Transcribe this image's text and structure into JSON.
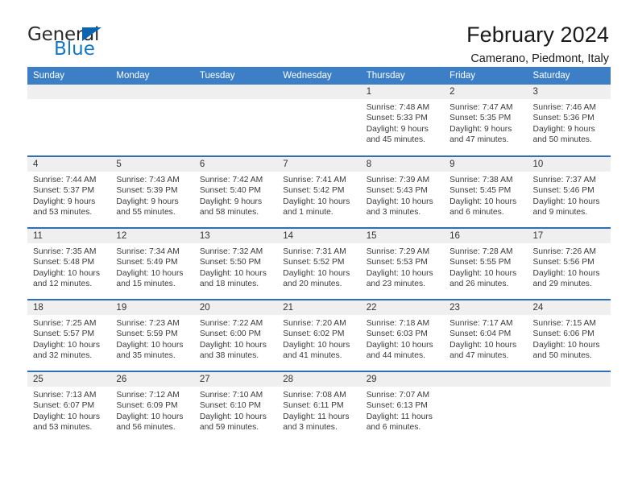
{
  "logo": {
    "word_one": "General",
    "word_two": "Blue",
    "triangle_color": "#0a64b0",
    "text_color": "#2a2a2a",
    "blue_color": "#1277c4"
  },
  "header": {
    "title": "February 2024",
    "subtitle": "Camerano, Piedmont, Italy",
    "header_bg": "#3c7fc6",
    "row_divider": "#2f6fb5",
    "daynum_bg": "#efefef"
  },
  "weekday_headers": [
    "Sunday",
    "Monday",
    "Tuesday",
    "Wednesday",
    "Thursday",
    "Friday",
    "Saturday"
  ],
  "weeks": [
    [
      {
        "day": "",
        "empty": true,
        "line1": "",
        "line2": "",
        "line3": "",
        "line4": ""
      },
      {
        "day": "",
        "empty": true,
        "line1": "",
        "line2": "",
        "line3": "",
        "line4": ""
      },
      {
        "day": "",
        "empty": true,
        "line1": "",
        "line2": "",
        "line3": "",
        "line4": ""
      },
      {
        "day": "",
        "empty": true,
        "line1": "",
        "line2": "",
        "line3": "",
        "line4": ""
      },
      {
        "day": "1",
        "empty": false,
        "line1": "Sunrise: 7:48 AM",
        "line2": "Sunset: 5:33 PM",
        "line3": "Daylight: 9 hours",
        "line4": "and 45 minutes."
      },
      {
        "day": "2",
        "empty": false,
        "line1": "Sunrise: 7:47 AM",
        "line2": "Sunset: 5:35 PM",
        "line3": "Daylight: 9 hours",
        "line4": "and 47 minutes."
      },
      {
        "day": "3",
        "empty": false,
        "line1": "Sunrise: 7:46 AM",
        "line2": "Sunset: 5:36 PM",
        "line3": "Daylight: 9 hours",
        "line4": "and 50 minutes."
      }
    ],
    [
      {
        "day": "4",
        "empty": false,
        "line1": "Sunrise: 7:44 AM",
        "line2": "Sunset: 5:37 PM",
        "line3": "Daylight: 9 hours",
        "line4": "and 53 minutes."
      },
      {
        "day": "5",
        "empty": false,
        "line1": "Sunrise: 7:43 AM",
        "line2": "Sunset: 5:39 PM",
        "line3": "Daylight: 9 hours",
        "line4": "and 55 minutes."
      },
      {
        "day": "6",
        "empty": false,
        "line1": "Sunrise: 7:42 AM",
        "line2": "Sunset: 5:40 PM",
        "line3": "Daylight: 9 hours",
        "line4": "and 58 minutes."
      },
      {
        "day": "7",
        "empty": false,
        "line1": "Sunrise: 7:41 AM",
        "line2": "Sunset: 5:42 PM",
        "line3": "Daylight: 10 hours",
        "line4": "and 1 minute."
      },
      {
        "day": "8",
        "empty": false,
        "line1": "Sunrise: 7:39 AM",
        "line2": "Sunset: 5:43 PM",
        "line3": "Daylight: 10 hours",
        "line4": "and 3 minutes."
      },
      {
        "day": "9",
        "empty": false,
        "line1": "Sunrise: 7:38 AM",
        "line2": "Sunset: 5:45 PM",
        "line3": "Daylight: 10 hours",
        "line4": "and 6 minutes."
      },
      {
        "day": "10",
        "empty": false,
        "line1": "Sunrise: 7:37 AM",
        "line2": "Sunset: 5:46 PM",
        "line3": "Daylight: 10 hours",
        "line4": "and 9 minutes."
      }
    ],
    [
      {
        "day": "11",
        "empty": false,
        "line1": "Sunrise: 7:35 AM",
        "line2": "Sunset: 5:48 PM",
        "line3": "Daylight: 10 hours",
        "line4": "and 12 minutes."
      },
      {
        "day": "12",
        "empty": false,
        "line1": "Sunrise: 7:34 AM",
        "line2": "Sunset: 5:49 PM",
        "line3": "Daylight: 10 hours",
        "line4": "and 15 minutes."
      },
      {
        "day": "13",
        "empty": false,
        "line1": "Sunrise: 7:32 AM",
        "line2": "Sunset: 5:50 PM",
        "line3": "Daylight: 10 hours",
        "line4": "and 18 minutes."
      },
      {
        "day": "14",
        "empty": false,
        "line1": "Sunrise: 7:31 AM",
        "line2": "Sunset: 5:52 PM",
        "line3": "Daylight: 10 hours",
        "line4": "and 20 minutes."
      },
      {
        "day": "15",
        "empty": false,
        "line1": "Sunrise: 7:29 AM",
        "line2": "Sunset: 5:53 PM",
        "line3": "Daylight: 10 hours",
        "line4": "and 23 minutes."
      },
      {
        "day": "16",
        "empty": false,
        "line1": "Sunrise: 7:28 AM",
        "line2": "Sunset: 5:55 PM",
        "line3": "Daylight: 10 hours",
        "line4": "and 26 minutes."
      },
      {
        "day": "17",
        "empty": false,
        "line1": "Sunrise: 7:26 AM",
        "line2": "Sunset: 5:56 PM",
        "line3": "Daylight: 10 hours",
        "line4": "and 29 minutes."
      }
    ],
    [
      {
        "day": "18",
        "empty": false,
        "line1": "Sunrise: 7:25 AM",
        "line2": "Sunset: 5:57 PM",
        "line3": "Daylight: 10 hours",
        "line4": "and 32 minutes."
      },
      {
        "day": "19",
        "empty": false,
        "line1": "Sunrise: 7:23 AM",
        "line2": "Sunset: 5:59 PM",
        "line3": "Daylight: 10 hours",
        "line4": "and 35 minutes."
      },
      {
        "day": "20",
        "empty": false,
        "line1": "Sunrise: 7:22 AM",
        "line2": "Sunset: 6:00 PM",
        "line3": "Daylight: 10 hours",
        "line4": "and 38 minutes."
      },
      {
        "day": "21",
        "empty": false,
        "line1": "Sunrise: 7:20 AM",
        "line2": "Sunset: 6:02 PM",
        "line3": "Daylight: 10 hours",
        "line4": "and 41 minutes."
      },
      {
        "day": "22",
        "empty": false,
        "line1": "Sunrise: 7:18 AM",
        "line2": "Sunset: 6:03 PM",
        "line3": "Daylight: 10 hours",
        "line4": "and 44 minutes."
      },
      {
        "day": "23",
        "empty": false,
        "line1": "Sunrise: 7:17 AM",
        "line2": "Sunset: 6:04 PM",
        "line3": "Daylight: 10 hours",
        "line4": "and 47 minutes."
      },
      {
        "day": "24",
        "empty": false,
        "line1": "Sunrise: 7:15 AM",
        "line2": "Sunset: 6:06 PM",
        "line3": "Daylight: 10 hours",
        "line4": "and 50 minutes."
      }
    ],
    [
      {
        "day": "25",
        "empty": false,
        "line1": "Sunrise: 7:13 AM",
        "line2": "Sunset: 6:07 PM",
        "line3": "Daylight: 10 hours",
        "line4": "and 53 minutes."
      },
      {
        "day": "26",
        "empty": false,
        "line1": "Sunrise: 7:12 AM",
        "line2": "Sunset: 6:09 PM",
        "line3": "Daylight: 10 hours",
        "line4": "and 56 minutes."
      },
      {
        "day": "27",
        "empty": false,
        "line1": "Sunrise: 7:10 AM",
        "line2": "Sunset: 6:10 PM",
        "line3": "Daylight: 10 hours",
        "line4": "and 59 minutes."
      },
      {
        "day": "28",
        "empty": false,
        "line1": "Sunrise: 7:08 AM",
        "line2": "Sunset: 6:11 PM",
        "line3": "Daylight: 11 hours",
        "line4": "and 3 minutes."
      },
      {
        "day": "29",
        "empty": false,
        "line1": "Sunrise: 7:07 AM",
        "line2": "Sunset: 6:13 PM",
        "line3": "Daylight: 11 hours",
        "line4": "and 6 minutes."
      },
      {
        "day": "",
        "empty": true,
        "line1": "",
        "line2": "",
        "line3": "",
        "line4": ""
      },
      {
        "day": "",
        "empty": true,
        "line1": "",
        "line2": "",
        "line3": "",
        "line4": ""
      }
    ]
  ]
}
